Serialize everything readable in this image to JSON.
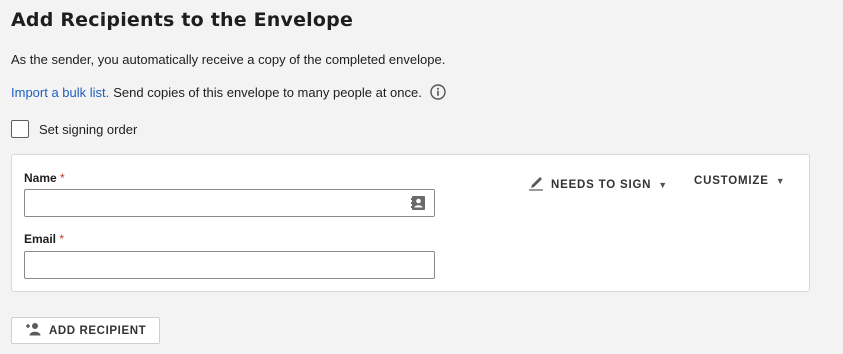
{
  "header": {
    "title": "Add Recipients to the Envelope",
    "sender_note": "As the sender, you automatically receive a copy of the completed envelope.",
    "import_link": "Import a bulk list.",
    "import_desc": "Send copies of this envelope to many people at once."
  },
  "signing_order": {
    "label": "Set signing order",
    "checked": false
  },
  "recipient": {
    "name_label": "Name",
    "email_label": "Email",
    "required_mark": "*",
    "name_value": "",
    "email_value": "",
    "role_label": "NEEDS TO SIGN",
    "customize_label": "CUSTOMIZE",
    "caret": "▼"
  },
  "add_recipient_label": "ADD RECIPIENT",
  "colors": {
    "link": "#1f5fbf",
    "required": "#c0392b",
    "background": "#f3f3f3"
  }
}
